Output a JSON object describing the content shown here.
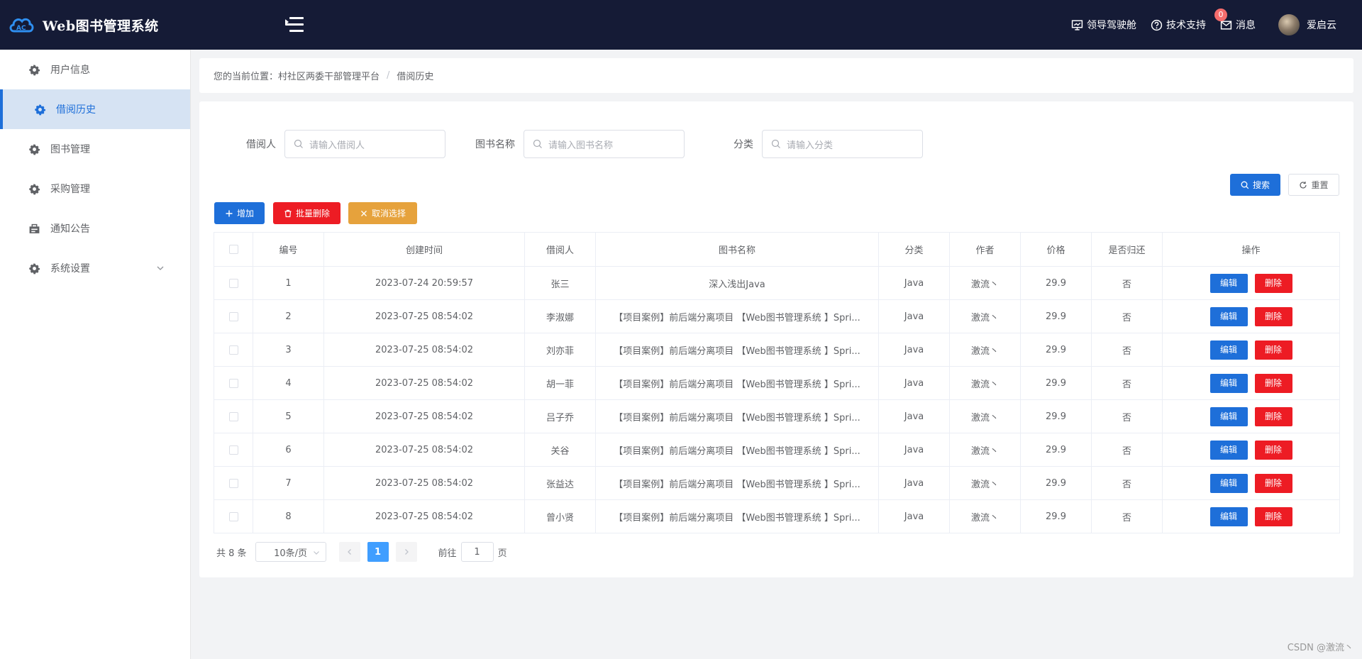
{
  "header": {
    "app_title": "Web图书管理系统",
    "links": [
      {
        "label": "领导驾驶舱",
        "icon": "monitor-icon"
      },
      {
        "label": "技术支持",
        "icon": "help-icon"
      },
      {
        "label": "消息",
        "icon": "mail-icon",
        "badge": "0"
      }
    ],
    "username": "爱启云"
  },
  "sidebar": {
    "items": [
      {
        "label": "用户信息"
      },
      {
        "label": "借阅历史"
      },
      {
        "label": "图书管理"
      },
      {
        "label": "采购管理"
      },
      {
        "label": "通知公告"
      },
      {
        "label": "系统设置"
      }
    ]
  },
  "breadcrumb": {
    "prefix": "您的当前位置：",
    "root": "村社区两委干部管理平台",
    "current": "借阅历史"
  },
  "filters": {
    "borrower_label": "借阅人",
    "borrower_placeholder": "请输入借阅人",
    "book_label": "图书名称",
    "book_placeholder": "请输入图书名称",
    "category_label": "分类",
    "category_placeholder": "请输入分类"
  },
  "actions": {
    "search": "搜索",
    "reset": "重置",
    "add": "增加",
    "batch_delete": "批量删除",
    "cancel_select": "取消选择"
  },
  "table": {
    "headers": [
      "编号",
      "创建时间",
      "借阅人",
      "图书名称",
      "分类",
      "作者",
      "价格",
      "是否归还",
      "操作"
    ],
    "edit_label": "编辑",
    "delete_label": "删除",
    "rows": [
      {
        "id": "1",
        "time": "2023-07-24 20:59:57",
        "borrower": "张三",
        "book": "深入浅出Java",
        "category": "Java",
        "author": "激流丶",
        "price": "29.9",
        "returned": "否"
      },
      {
        "id": "2",
        "time": "2023-07-25 08:54:02",
        "borrower": "李淑娜",
        "book": "【项目案例】前后端分离项目 【Web图书管理系统 】Spri...",
        "category": "Java",
        "author": "激流丶",
        "price": "29.9",
        "returned": "否"
      },
      {
        "id": "3",
        "time": "2023-07-25 08:54:02",
        "borrower": "刘亦菲",
        "book": "【项目案例】前后端分离项目 【Web图书管理系统 】Spri...",
        "category": "Java",
        "author": "激流丶",
        "price": "29.9",
        "returned": "否"
      },
      {
        "id": "4",
        "time": "2023-07-25 08:54:02",
        "borrower": "胡一菲",
        "book": "【项目案例】前后端分离项目 【Web图书管理系统 】Spri...",
        "category": "Java",
        "author": "激流丶",
        "price": "29.9",
        "returned": "否"
      },
      {
        "id": "5",
        "time": "2023-07-25 08:54:02",
        "borrower": "吕子乔",
        "book": "【项目案例】前后端分离项目 【Web图书管理系统 】Spri...",
        "category": "Java",
        "author": "激流丶",
        "price": "29.9",
        "returned": "否"
      },
      {
        "id": "6",
        "time": "2023-07-25 08:54:02",
        "borrower": "关谷",
        "book": "【项目案例】前后端分离项目 【Web图书管理系统 】Spri...",
        "category": "Java",
        "author": "激流丶",
        "price": "29.9",
        "returned": "否"
      },
      {
        "id": "7",
        "time": "2023-07-25 08:54:02",
        "borrower": "张益达",
        "book": "【项目案例】前后端分离项目 【Web图书管理系统 】Spri...",
        "category": "Java",
        "author": "激流丶",
        "price": "29.9",
        "returned": "否"
      },
      {
        "id": "8",
        "time": "2023-07-25 08:54:02",
        "borrower": "曾小贤",
        "book": "【项目案例】前后端分离项目 【Web图书管理系统 】Spri...",
        "category": "Java",
        "author": "激流丶",
        "price": "29.9",
        "returned": "否"
      }
    ]
  },
  "pagination": {
    "total": "共 8 条",
    "page_size": "10条/页",
    "current_page": "1",
    "goto_label": "前往",
    "goto_value": "1",
    "page_suffix": "页"
  },
  "watermark": "CSDN @激流丶",
  "colors": {
    "header_bg": "#151b36",
    "primary": "#1e6fd9",
    "danger": "#ed1c24",
    "warning": "#e6a23c",
    "active_menu_bg": "#d6e3f3"
  }
}
